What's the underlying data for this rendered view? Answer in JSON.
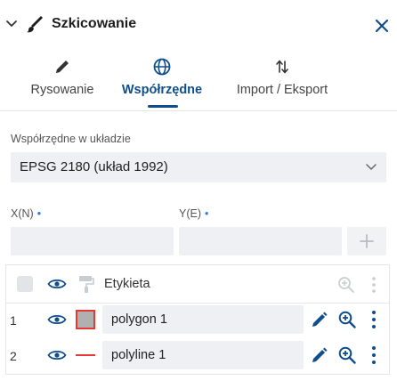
{
  "header": {
    "title": "Szkicowanie",
    "icons": {
      "collapse": "chevron-down-icon",
      "brush": "brush-icon",
      "close": "close-icon"
    }
  },
  "tabs": [
    {
      "label": "Rysowanie",
      "icon": "pencil-icon",
      "active": false
    },
    {
      "label": "Współrzędne",
      "icon": "globe-icon",
      "active": true
    },
    {
      "label": "Import / Eksport",
      "icon": "import-export-arrows-icon",
      "active": false
    }
  ],
  "coordinate_system": {
    "label": "Współrzędne w układzie",
    "selected": "EPSG 2180 (układ 1992)"
  },
  "coordinates": {
    "x_label": "X(N)",
    "y_label": "Y(E)",
    "required_marker": "•",
    "x_value": "",
    "y_value": "",
    "add_label": "+"
  },
  "table": {
    "header": {
      "label": "Etykieta"
    },
    "rows": [
      {
        "index": "1",
        "name": "polygon 1",
        "style": "polygon",
        "stroke": "#e53935",
        "fill": "#b0b0b0"
      },
      {
        "index": "2",
        "name": "polyline 1",
        "style": "polyline",
        "stroke": "#e53935"
      }
    ]
  },
  "colors": {
    "accent": "#0f4e8c",
    "required": "#2a7de1",
    "field_bg": "#eef0f3",
    "feature_stroke": "#e53935"
  }
}
